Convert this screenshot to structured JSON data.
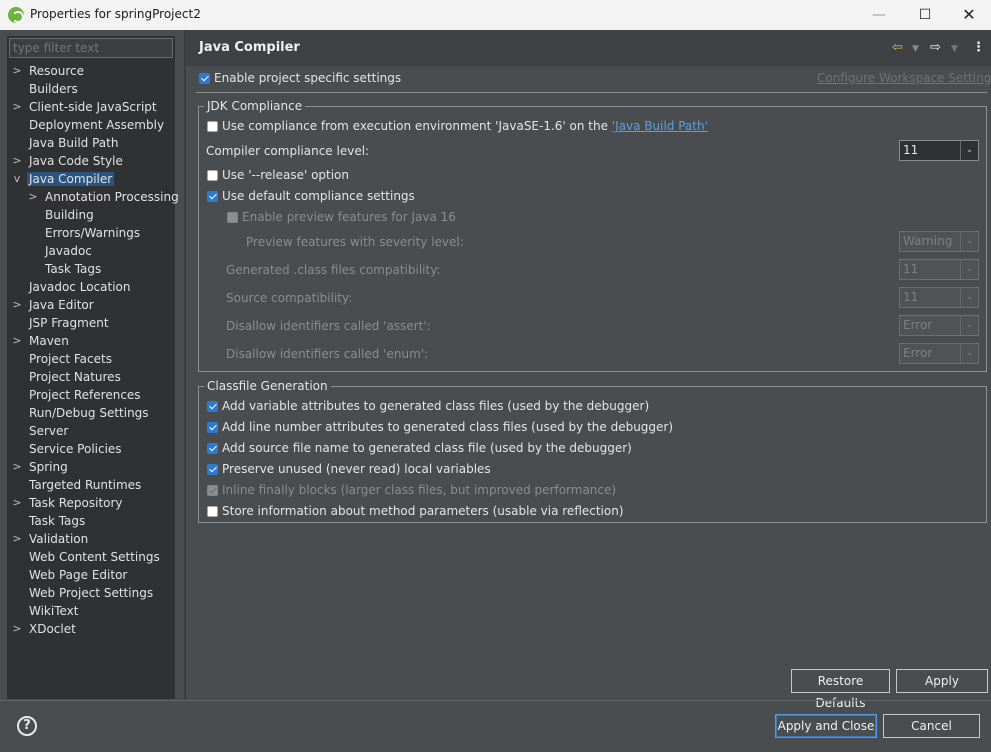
{
  "window": {
    "title": "Properties for springProject2",
    "min_glyph": "—",
    "max_glyph": "☐",
    "close_glyph": "✕"
  },
  "sidebar": {
    "filter_placeholder": "type filter text",
    "items": [
      {
        "label": "Resource",
        "expand": ">"
      },
      {
        "label": "Builders",
        "expand": ""
      },
      {
        "label": "Client-side JavaScript",
        "expand": ">"
      },
      {
        "label": "Deployment Assembly",
        "expand": ""
      },
      {
        "label": "Java Build Path",
        "expand": ""
      },
      {
        "label": "Java Code Style",
        "expand": ">"
      },
      {
        "label": "Java Compiler",
        "expand": "v"
      },
      {
        "label": "Annotation Processing",
        "expand": ">"
      },
      {
        "label": "Building",
        "expand": ""
      },
      {
        "label": "Errors/Warnings",
        "expand": ""
      },
      {
        "label": "Javadoc",
        "expand": ""
      },
      {
        "label": "Task Tags",
        "expand": ""
      },
      {
        "label": "Javadoc Location",
        "expand": ""
      },
      {
        "label": "Java Editor",
        "expand": ">"
      },
      {
        "label": "JSP Fragment",
        "expand": ""
      },
      {
        "label": "Maven",
        "expand": ">"
      },
      {
        "label": "Project Facets",
        "expand": ""
      },
      {
        "label": "Project Natures",
        "expand": ""
      },
      {
        "label": "Project References",
        "expand": ""
      },
      {
        "label": "Run/Debug Settings",
        "expand": ""
      },
      {
        "label": "Server",
        "expand": ""
      },
      {
        "label": "Service Policies",
        "expand": ""
      },
      {
        "label": "Spring",
        "expand": ">"
      },
      {
        "label": "Targeted Runtimes",
        "expand": ""
      },
      {
        "label": "Task Repository",
        "expand": ">"
      },
      {
        "label": "Task Tags",
        "expand": ""
      },
      {
        "label": "Validation",
        "expand": ">"
      },
      {
        "label": "Web Content Settings",
        "expand": ""
      },
      {
        "label": "Web Page Editor",
        "expand": ""
      },
      {
        "label": "Web Project Settings",
        "expand": ""
      },
      {
        "label": "WikiText",
        "expand": ""
      },
      {
        "label": "XDoclet",
        "expand": ">"
      }
    ]
  },
  "header": {
    "title": "Java Compiler",
    "back_glyph": "⇦",
    "dropdown_glyph": "▼",
    "forward_glyph": "⇨",
    "menu_glyph": "⋮"
  },
  "main": {
    "enable_project_specific": "Enable project specific settings",
    "configure_workspace": "Configure Workspace Settings...",
    "jdk": {
      "title": "JDK Compliance",
      "use_env_prefix": "Use compliance from execution environment 'JavaSE-1.6' on the ",
      "use_env_link": "'Java Build Path'",
      "compliance_level_label": "Compiler compliance level:",
      "compliance_level_value": "11",
      "use_release": "Use '--release' option",
      "use_default": "Use default compliance settings",
      "enable_preview": "Enable preview features for Java 16",
      "preview_severity_label": "Preview features with severity level:",
      "preview_severity_value": "Warning",
      "generated_class_label": "Generated .class files compatibility:",
      "generated_class_value": "11",
      "source_compat_label": "Source compatibility:",
      "source_compat_value": "11",
      "disallow_assert_label": "Disallow identifiers called 'assert':",
      "disallow_assert_value": "Error",
      "disallow_enum_label": "Disallow identifiers called 'enum':",
      "disallow_enum_value": "Error",
      "combo_arrow": "⌄"
    },
    "classfile": {
      "title": "Classfile Generation",
      "add_variable": "Add variable attributes to generated class files (used by the debugger)",
      "add_line_number": "Add line number attributes to generated class files (used by the debugger)",
      "add_source_file": "Add source file name to generated class file (used by the debugger)",
      "preserve_unused": "Preserve unused (never read) local variables",
      "inline_finally": "Inline finally blocks (larger class files, but improved performance)",
      "store_params": "Store information about method parameters (usable via reflection)"
    },
    "restore_defaults": "Restore Defaults",
    "apply": "Apply"
  },
  "footer": {
    "help_glyph": "?",
    "apply_and_close": "Apply and Close",
    "cancel": "Cancel"
  }
}
